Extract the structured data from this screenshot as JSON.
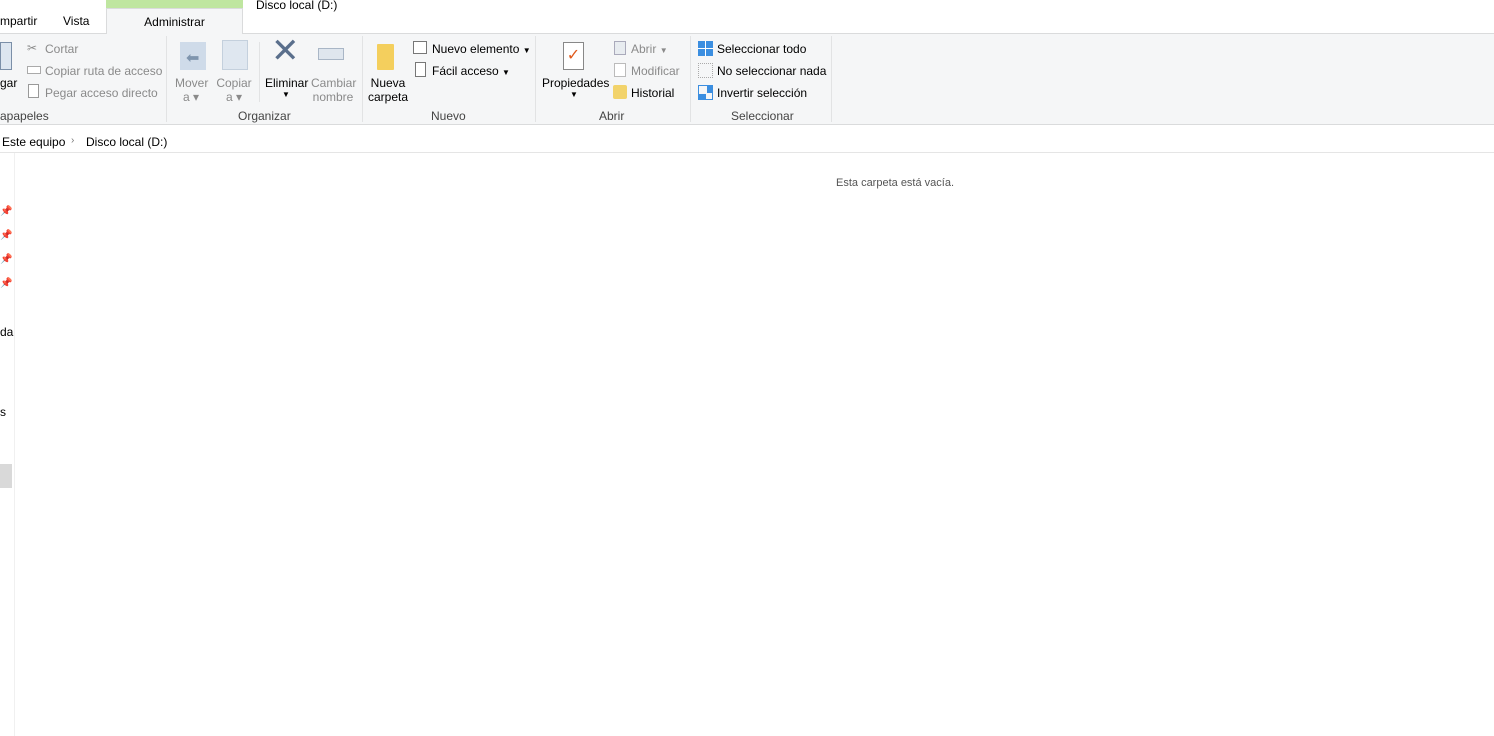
{
  "window": {
    "title": "Disco local (D:)"
  },
  "tabs": [
    {
      "label": "mpartir"
    },
    {
      "label": "Vista"
    },
    {
      "label": "Administrar"
    }
  ],
  "ribbon": {
    "portapapeles": {
      "pegar": "gar",
      "cortar": "Cortar",
      "copiar_ruta": "Copiar ruta de acceso",
      "pegar_acceso": "Pegar acceso directo",
      "group": "apapeles"
    },
    "organizar": {
      "mover1": "Mover",
      "mover2": "a",
      "copiar1": "Copiar",
      "copiar2": "a",
      "eliminar": "Eliminar",
      "cambiar1": "Cambiar",
      "cambiar2": "nombre",
      "group": "Organizar"
    },
    "nuevo": {
      "nueva1": "Nueva",
      "nueva2": "carpeta",
      "nuevo_elemento": "Nuevo elemento",
      "facil_acceso": "Fácil acceso",
      "group": "Nuevo"
    },
    "abrir": {
      "propiedades": "Propiedades",
      "abrir": "Abrir",
      "modificar": "Modificar",
      "historial": "Historial",
      "group": "Abrir"
    },
    "seleccionar": {
      "todo": "Seleccionar todo",
      "nada": "No seleccionar nada",
      "invertir": "Invertir selección",
      "group": "Seleccionar"
    }
  },
  "breadcrumb": [
    "Este equipo",
    "Disco local (D:)"
  ],
  "nav": {
    "item1": "da",
    "item2": "s"
  },
  "content": {
    "empty": "Esta carpeta está vacía."
  }
}
